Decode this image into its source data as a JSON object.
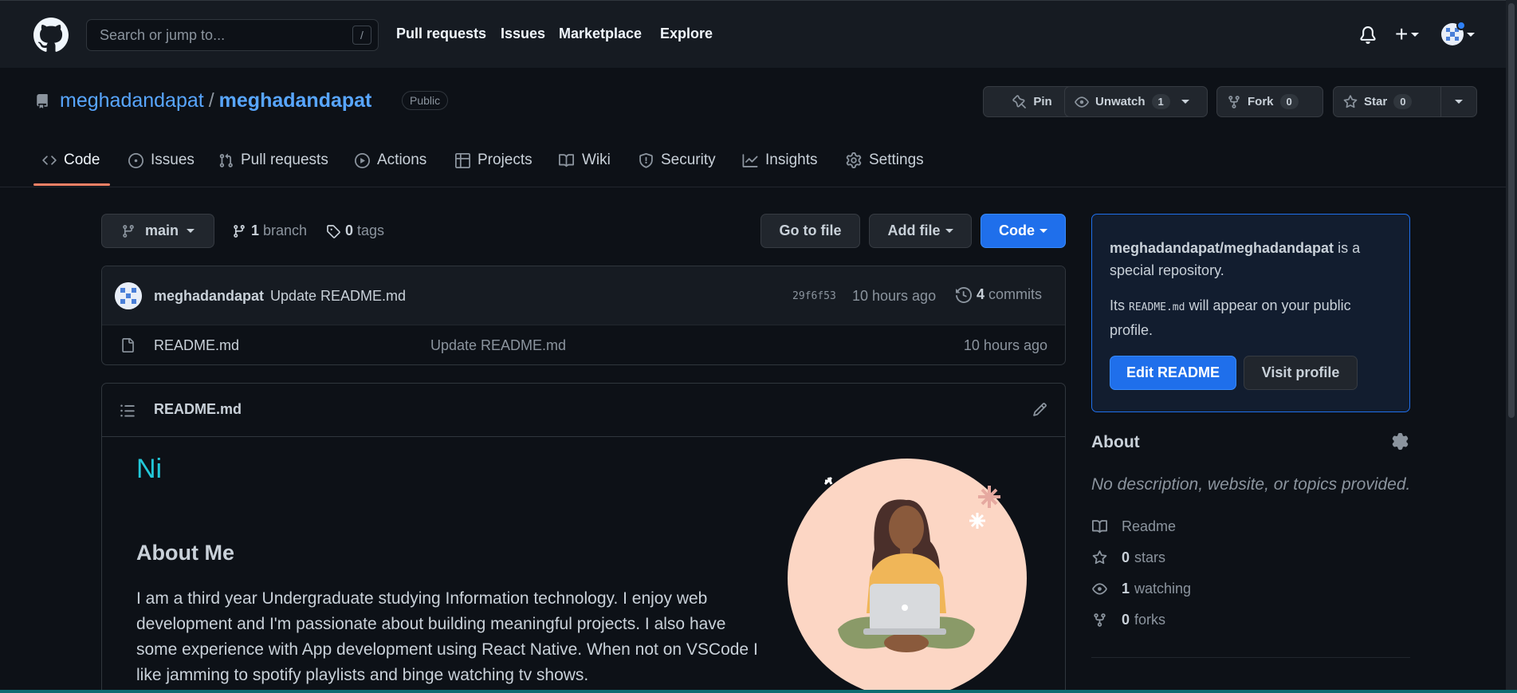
{
  "header": {
    "search_placeholder": "Search or jump to...",
    "slash_key": "/",
    "nav": [
      "Pull requests",
      "Issues",
      "Marketplace",
      "Explore"
    ],
    "plus": "+"
  },
  "repo": {
    "owner": "meghadandapat",
    "separator": "/",
    "name": "meghadandapat",
    "visibility": "Public",
    "pin_label": "Pin",
    "unwatch_label": "Unwatch",
    "watch_count": "1",
    "fork_label": "Fork",
    "fork_count": "0",
    "star_label": "Star",
    "star_count": "0"
  },
  "tabs": [
    "Code",
    "Issues",
    "Pull requests",
    "Actions",
    "Projects",
    "Wiki",
    "Security",
    "Insights",
    "Settings"
  ],
  "filenav": {
    "branch": "main",
    "branch_count": "1",
    "branch_label": "branch",
    "tag_count": "0",
    "tag_label": "tags",
    "go_to_file": "Go to file",
    "add_file": "Add file",
    "code": "Code"
  },
  "commit": {
    "author": "meghadandapat",
    "message": "Update README.md",
    "sha": "29f6f53",
    "time": "10 hours ago",
    "count": "4",
    "count_label": "commits"
  },
  "files": [
    {
      "name": "README.md",
      "message": "Update README.md",
      "time": "10 hours ago"
    }
  ],
  "readme": {
    "title": "README.md",
    "greeting": "Ni",
    "about_heading": "About Me",
    "about_text": "I am a third year Undergraduate studying Information technology. I enjoy web development and I'm passionate about building meaningful projects. I also have some experience with App development using React Native. When not on VSCode I like jamming to spotify playlists and binge watching tv shows."
  },
  "special": {
    "repo_path": "meghadandapat/meghadandapat",
    "suffix": " is a special repository.",
    "its": "Its ",
    "file": "README.md",
    "appear": " will appear on your public profile.",
    "edit_button": "Edit README",
    "visit_button": "Visit profile"
  },
  "about": {
    "title": "About",
    "description": "No description, website, or topics provided.",
    "readme_label": "Readme",
    "stars_count": "0",
    "stars_label": "stars",
    "watching_count": "1",
    "watching_label": "watching",
    "forks_count": "0",
    "forks_label": "forks"
  },
  "colors": {
    "accent": "#58a6ff",
    "primary_button": "#1f6feb",
    "tab_underline": "#f78166",
    "greeting": "#22c7d8"
  }
}
